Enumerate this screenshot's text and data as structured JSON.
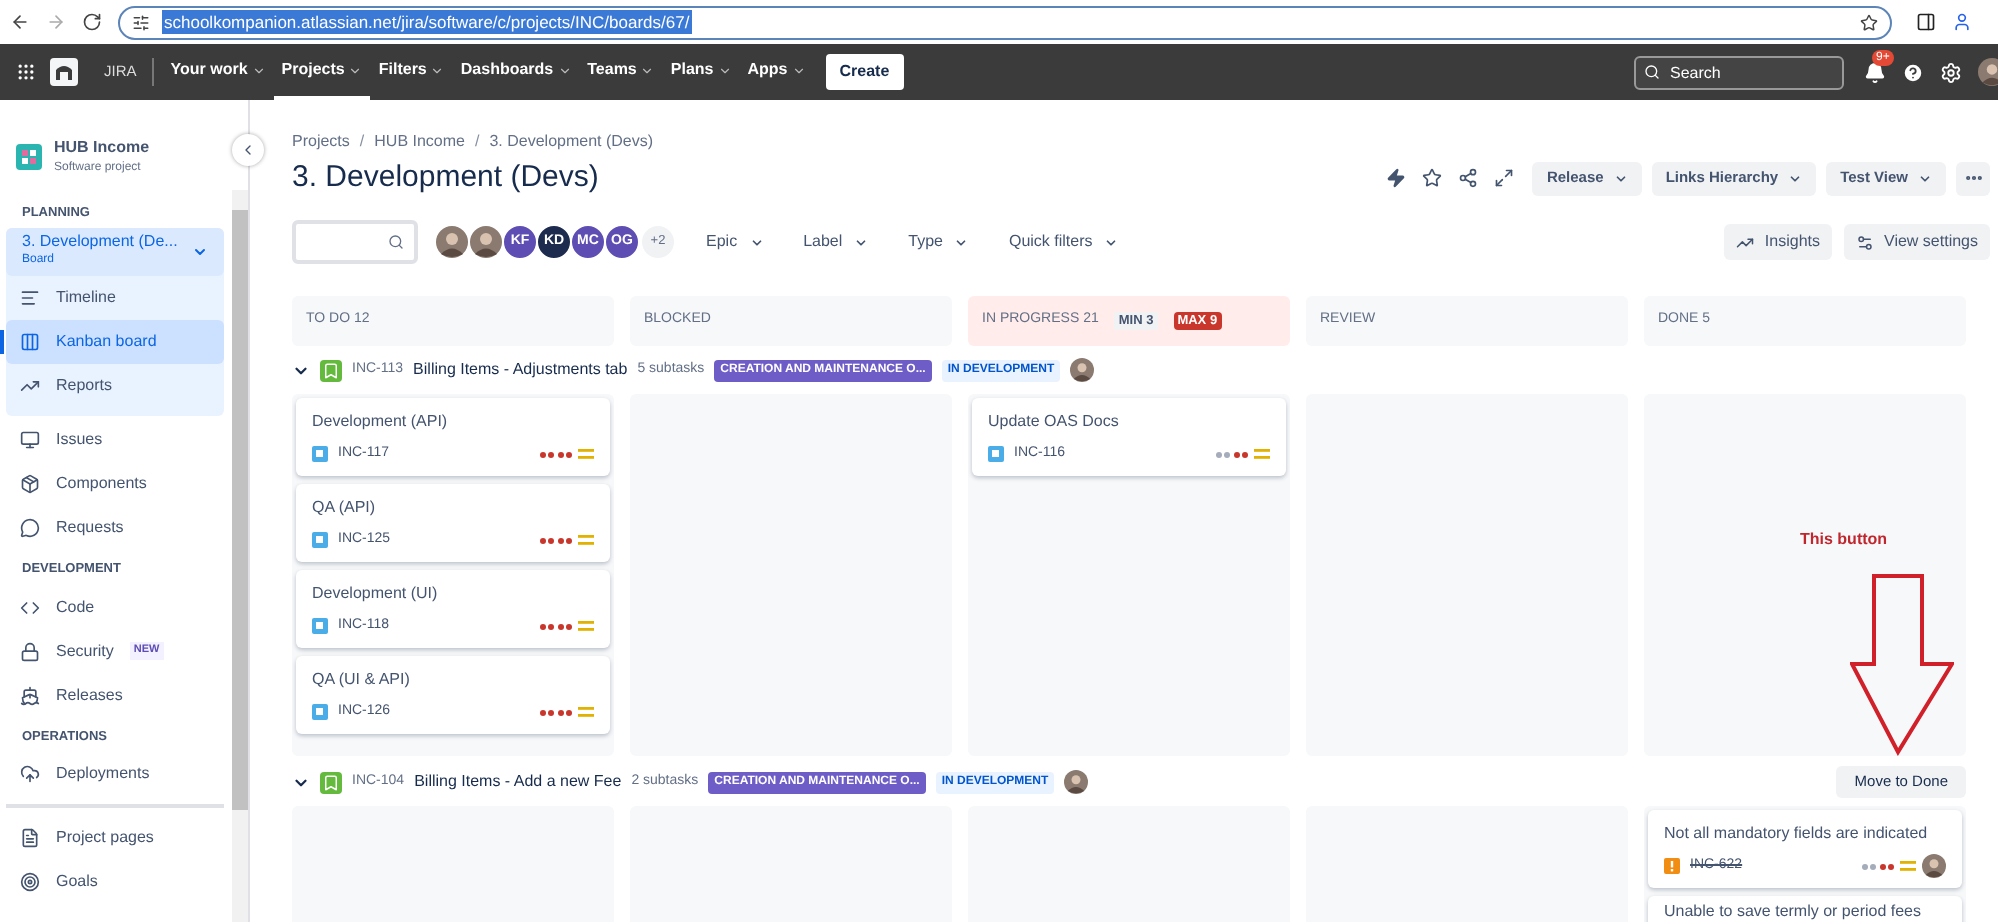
{
  "browser": {
    "url": "schoolkompanion.atlassian.net/jira/software/c/projects/INC/boards/67/"
  },
  "nav": {
    "app_name": "JIRA",
    "items": [
      {
        "label": "Your work",
        "selected": false
      },
      {
        "label": "Projects",
        "selected": true
      },
      {
        "label": "Filters",
        "selected": false
      },
      {
        "label": "Dashboards",
        "selected": false
      },
      {
        "label": "Teams",
        "selected": false
      },
      {
        "label": "Plans",
        "selected": false
      },
      {
        "label": "Apps",
        "selected": false
      }
    ],
    "create": "Create",
    "search": {
      "placeholder": "Search"
    },
    "notifications": "9+"
  },
  "sidebar": {
    "project": {
      "name": "HUB Income",
      "type": "Software project"
    },
    "sections": [
      {
        "heading": "PLANNING",
        "items": [
          {
            "kind": "board",
            "label": "3. Development (De...",
            "sublabel": "Board",
            "selected": false
          },
          {
            "kind": "link",
            "label": "Timeline",
            "selected": false
          },
          {
            "kind": "link",
            "label": "Kanban board",
            "selected": true
          },
          {
            "kind": "link",
            "label": "Reports",
            "selected": false
          }
        ]
      },
      {
        "items": [
          {
            "kind": "link",
            "label": "Issues",
            "selected": false
          },
          {
            "kind": "link",
            "label": "Components",
            "selected": false
          },
          {
            "kind": "link",
            "label": "Requests",
            "selected": false
          }
        ]
      },
      {
        "heading": "DEVELOPMENT",
        "items": [
          {
            "kind": "link",
            "label": "Code",
            "selected": false
          },
          {
            "kind": "link",
            "label": "Security",
            "badge": "NEW",
            "selected": false
          },
          {
            "kind": "link",
            "label": "Releases",
            "selected": false
          }
        ]
      },
      {
        "heading": "OPERATIONS",
        "items": [
          {
            "kind": "link",
            "label": "Deployments",
            "selected": false
          }
        ]
      },
      {
        "items": [
          {
            "kind": "link",
            "label": "Project pages",
            "selected": false
          },
          {
            "kind": "link",
            "label": "Goals",
            "selected": false
          }
        ]
      }
    ]
  },
  "breadcrumbs": [
    "Projects",
    "HUB Income",
    "3. Development (Devs)"
  ],
  "breadcrumb_separator": "/",
  "title": "3. Development (Devs)",
  "header_buttons": [
    "Release",
    "Links Hierarchy",
    "Test View"
  ],
  "avatars": [
    {
      "kind": "photo"
    },
    {
      "kind": "photo"
    },
    {
      "kind": "initials",
      "initials": "KF",
      "color": "#5e4db2"
    },
    {
      "kind": "initials",
      "initials": "KD",
      "color": "#1d2b4f"
    },
    {
      "kind": "initials",
      "initials": "MC",
      "color": "#5e4db2"
    },
    {
      "kind": "initials",
      "initials": "OG",
      "color": "#5e4db2"
    }
  ],
  "more_avatars": "+2",
  "filters": [
    "Epic",
    "Label",
    "Type",
    "Quick filters"
  ],
  "toolbar_buttons": [
    "Insights",
    "View settings"
  ],
  "columns": [
    {
      "title": "TO DO 12",
      "over_limit": false
    },
    {
      "title": "BLOCKED",
      "over_limit": false
    },
    {
      "title": "IN PROGRESS 21",
      "min": "MIN 3",
      "max": "MAX 9",
      "over_limit": true
    },
    {
      "title": "REVIEW",
      "over_limit": false
    },
    {
      "title": "DONE 5",
      "over_limit": false
    }
  ],
  "swimlanes": [
    {
      "key": "INC-113",
      "title": "Billing Items - Adjustments tab",
      "subtasks": "5 subtasks",
      "epic": "CREATION AND MAINTENANCE O...",
      "status": "IN DEVELOPMENT",
      "expanded": true,
      "cells": [
        [
          {
            "kind": "subtask",
            "title": "Development (API)",
            "key": "INC-117",
            "stars": 4,
            "done": false
          },
          {
            "kind": "subtask",
            "title": "QA (API)",
            "key": "INC-125",
            "stars": 4,
            "done": false
          },
          {
            "kind": "subtask",
            "title": "Development (UI)",
            "key": "INC-118",
            "stars": 4,
            "done": false
          },
          {
            "kind": "subtask",
            "title": "QA (UI & API)",
            "key": "INC-126",
            "stars": 4,
            "done": false
          }
        ],
        [],
        [
          {
            "kind": "subtask",
            "title": "Update OAS Docs",
            "key": "INC-116",
            "stars": 2,
            "done": false
          }
        ],
        [],
        []
      ]
    },
    {
      "key": "INC-104",
      "title": "Billing Items - Add a new Fee",
      "subtasks": "2 subtasks",
      "epic": "CREATION AND MAINTENANCE O...",
      "status": "IN DEVELOPMENT",
      "expanded": true,
      "action": "Move to Done",
      "cells": [
        [],
        [],
        [],
        [],
        [
          {
            "kind": "bug",
            "title": "Not all mandatory fields are indicated",
            "key": "INC-622",
            "stars": 2,
            "done": true,
            "assigned": true
          },
          {
            "kind": "cut",
            "title": "Unable to save termly or period fees"
          }
        ]
      ]
    }
  ],
  "annotation": {
    "text": "This button"
  }
}
